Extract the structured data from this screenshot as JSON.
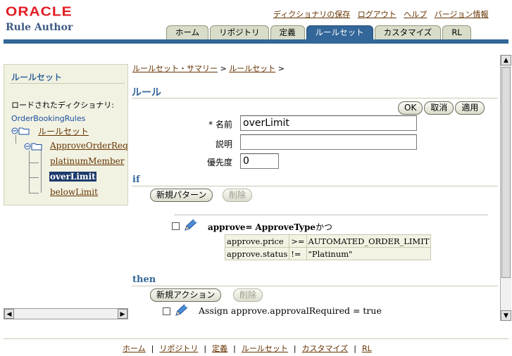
{
  "brand": {
    "logo": "ORACLE",
    "product": "Rule Author"
  },
  "global_links": [
    "ディクショナリの保存",
    "ログアウト",
    "ヘルプ",
    "バージョン情報"
  ],
  "tabs": [
    {
      "label": "ホーム"
    },
    {
      "label": "リポジトリ"
    },
    {
      "label": "定義"
    },
    {
      "label": "ルールセット"
    },
    {
      "label": "カスタマイズ"
    },
    {
      "label": "RL"
    }
  ],
  "active_tab": "ルールセット",
  "colors": {
    "accent": "#336699",
    "link": "#663300",
    "oracle_red": "#e31b23",
    "panel_bg": "#f2f2e3"
  },
  "sidebar": {
    "header": "ルールセット",
    "loaded_label": "ロードされたディクショナリ:",
    "dictionary": "OrderBookingRules",
    "tree": {
      "root": "ルールセット",
      "ruleset": "ApproveOrderRequir",
      "rules": [
        "platinumMember",
        "overLimit",
        "belowLimit"
      ]
    },
    "selected_rule": "overLimit"
  },
  "breadcrumb": {
    "items": [
      "ルールセット・サマリー",
      "ルールセット"
    ],
    "separator": ">"
  },
  "page_title": "ルール",
  "actions": {
    "ok": "OK",
    "cancel": "取消",
    "apply": "適用"
  },
  "form": {
    "name_label": "* 名前",
    "name_value": "overLimit",
    "desc_label": "説明",
    "desc_value": "",
    "priority_label": "優先度",
    "priority_value": "0"
  },
  "if_section": {
    "title": "if",
    "new_pattern": "新規パターン",
    "delete": "削除",
    "pattern_var": "approve",
    "pattern_eq": "=",
    "pattern_type": "ApproveType",
    "pattern_suffix": "かつ",
    "conditions": [
      {
        "left": "approve.price",
        "op": ">=",
        "right": "AUTOMATED_ORDER_LIMIT"
      },
      {
        "left": "approve.status",
        "op": "!=",
        "right": "\"Platinum\""
      }
    ]
  },
  "then_section": {
    "title": "then",
    "new_action": "新規アクション",
    "delete": "削除",
    "action_text": "Assign approve.approvalRequired = true"
  },
  "footer_links": [
    "ホーム",
    "リポジトリ",
    "定義",
    "ルールセット",
    "カスタマイズ",
    "RL"
  ]
}
